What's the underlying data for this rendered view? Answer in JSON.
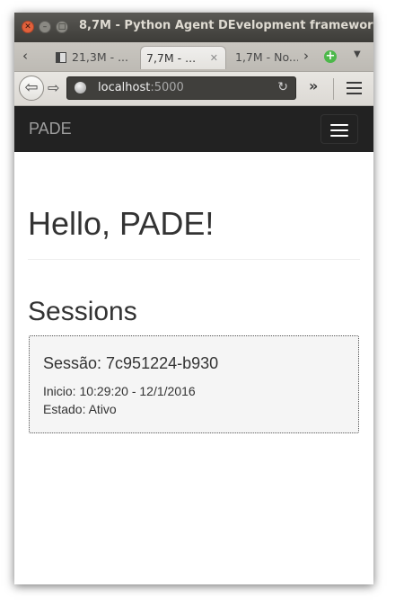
{
  "window": {
    "title": "8,7M - Python Agent DEvelopment framework"
  },
  "tabs": [
    {
      "label": "21,3M - ..."
    },
    {
      "label": "7,7M - ..."
    },
    {
      "label": "1,7M - No..."
    }
  ],
  "toolbar": {
    "url_host": "localhost",
    "url_port": ":5000"
  },
  "app": {
    "brand": "PADE",
    "heading": "Hello, PADE!",
    "sessions_heading": "Sessions",
    "session": {
      "title": "Sessão: 7c951224-b930",
      "start": "Inicio: 10:29:20 - 12/1/2016",
      "state": "Estado: Ativo"
    }
  }
}
